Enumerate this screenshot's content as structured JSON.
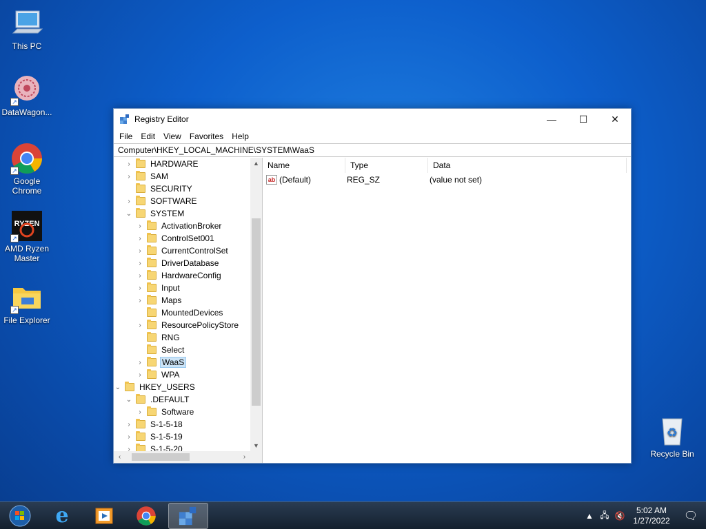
{
  "desktop": {
    "icons": [
      {
        "label": "This PC"
      },
      {
        "label": "DataWagon..."
      },
      {
        "label": "Google Chrome"
      },
      {
        "label": "AMD Ryzen Master"
      },
      {
        "label": "File Explorer"
      },
      {
        "label": "Recycle Bin"
      }
    ]
  },
  "window": {
    "title": "Registry Editor",
    "controls": {
      "minimize": "—",
      "maximize": "☐",
      "close": "✕"
    },
    "menu": [
      "File",
      "Edit",
      "View",
      "Favorites",
      "Help"
    ],
    "address": "Computer\\HKEY_LOCAL_MACHINE\\SYSTEM\\WaaS",
    "tree": [
      {
        "label": "HARDWARE",
        "chevron": "›"
      },
      {
        "label": "SAM",
        "chevron": "›"
      },
      {
        "label": "SECURITY",
        "chevron": ""
      },
      {
        "label": "SOFTWARE",
        "chevron": "›"
      },
      {
        "label": "SYSTEM",
        "chevron": "⌄"
      },
      {
        "label": "ActivationBroker",
        "chevron": "›"
      },
      {
        "label": "ControlSet001",
        "chevron": "›"
      },
      {
        "label": "CurrentControlSet",
        "chevron": "›"
      },
      {
        "label": "DriverDatabase",
        "chevron": "›"
      },
      {
        "label": "HardwareConfig",
        "chevron": "›"
      },
      {
        "label": "Input",
        "chevron": "›"
      },
      {
        "label": "Maps",
        "chevron": "›"
      },
      {
        "label": "MountedDevices",
        "chevron": ""
      },
      {
        "label": "ResourcePolicyStore",
        "chevron": "›"
      },
      {
        "label": "RNG",
        "chevron": ""
      },
      {
        "label": "Select",
        "chevron": ""
      },
      {
        "label": "WaaS",
        "chevron": "›",
        "selected": true
      },
      {
        "label": "WPA",
        "chevron": "›"
      },
      {
        "label": "HKEY_USERS",
        "chevron": "⌄"
      },
      {
        "label": ".DEFAULT",
        "chevron": "⌄"
      },
      {
        "label": "Software",
        "chevron": "›"
      },
      {
        "label": "S-1-5-18",
        "chevron": "›"
      },
      {
        "label": "S-1-5-19",
        "chevron": "›"
      },
      {
        "label": "S-1-5-20",
        "chevron": "›"
      }
    ],
    "columns": {
      "name": "Name",
      "type": "Type",
      "data": "Data"
    },
    "values": [
      {
        "icon": "ab",
        "name": "(Default)",
        "type": "REG_SZ",
        "data": "(value not set)"
      }
    ]
  },
  "taskbar": {
    "clock": {
      "time": "5:02 AM",
      "date": "1/27/2022"
    }
  }
}
